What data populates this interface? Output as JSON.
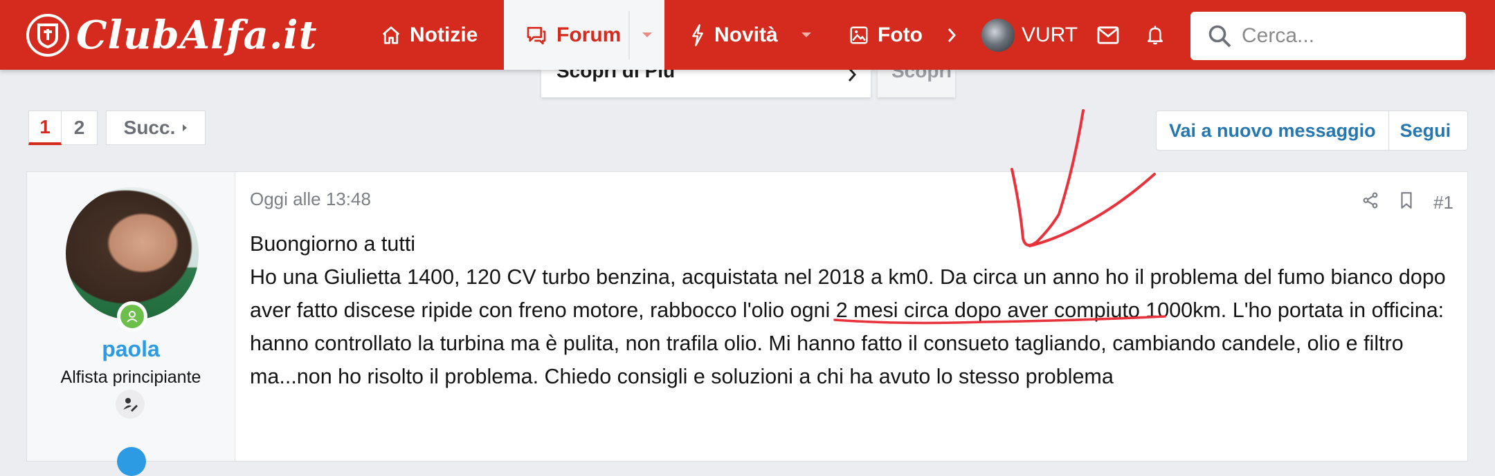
{
  "navbar": {
    "logo_text": "ClubAlfa.it",
    "items": [
      {
        "label": "Notizie",
        "icon": "home-icon"
      },
      {
        "label": "Forum",
        "icon": "chat-icon",
        "active": true
      },
      {
        "label": "Novità",
        "icon": "bolt-icon"
      },
      {
        "label": "Foto",
        "icon": "image-icon"
      }
    ],
    "user": {
      "name": "VURT"
    },
    "search": {
      "placeholder": "Cerca..."
    },
    "dropdown_items": [
      "Scopri di Più",
      "Scopri"
    ]
  },
  "pagination": {
    "pages": [
      "1",
      "2"
    ],
    "current": "1",
    "next_label": "Succ."
  },
  "thread_actions": {
    "new_message": "Vai a nuovo messaggio",
    "follow": "Segui"
  },
  "post": {
    "user": {
      "name": "paola",
      "title": "Alfista principiante"
    },
    "date": "Oggi alle 13:48",
    "number": "#1",
    "greeting": "Buongiorno a tutti",
    "text_before": "Ho una Giulietta 1400, 120 CV turbo benzina, acquistata nel 2018 a km0. Da circa un anno ho il problema del fumo bianco dopo aver fatto discese ripide con freno motore, ",
    "text_highlight": "rabbocco l'olio ogni 2 mesi circa",
    "text_after": " dopo aver compiuto 1000km. L'ho portata in officina: hanno controllato la turbina ma è pulita, non trafila olio. Mi hanno fatto il consueto tagliando, cambiando candele, olio e filtro ma...non ho risolto il problema. Chiedo consigli e soluzioni a chi ha avuto lo stesso problema"
  },
  "colors": {
    "brand": "#d42b1e",
    "link": "#2577b1",
    "username": "#2d9be3",
    "annotation": "#e8323c"
  }
}
